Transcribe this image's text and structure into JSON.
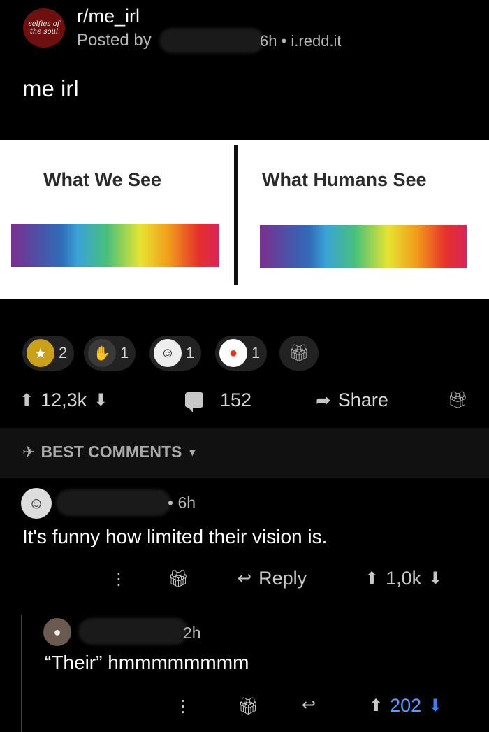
{
  "header": {
    "subreddit_avatar_text": "selfies of the soul",
    "subreddit": "r/me_irl",
    "posted_by": "Posted by",
    "meta": "6h • i.redd.it"
  },
  "post": {
    "title": "me irl"
  },
  "meme": {
    "left_label": "What We See",
    "right_label": "What Humans See"
  },
  "awards": [
    {
      "icon": "gold-award-icon",
      "count": "2"
    },
    {
      "icon": "clap-award-icon",
      "count": "1"
    },
    {
      "icon": "face-award-icon",
      "count": "1"
    },
    {
      "icon": "snoo-award-icon",
      "count": "1"
    },
    {
      "icon": "gift-icon",
      "count": ""
    }
  ],
  "actions": {
    "votes": "12,3k",
    "comments": "152",
    "share": "Share"
  },
  "sort": {
    "label": "BEST COMMENTS"
  },
  "comments": [
    {
      "time": "• 6h",
      "body": "It's funny how limited their vision is.",
      "reply_label": "Reply",
      "votes": "1,0k"
    },
    {
      "time": "2h",
      "body": "“Their” hmmmmmmmm",
      "votes": "202"
    }
  ],
  "colors": {
    "background": "#000000",
    "upvoted_blue": "#3b82f6",
    "subreddit_avatar": "#6e0f10"
  }
}
